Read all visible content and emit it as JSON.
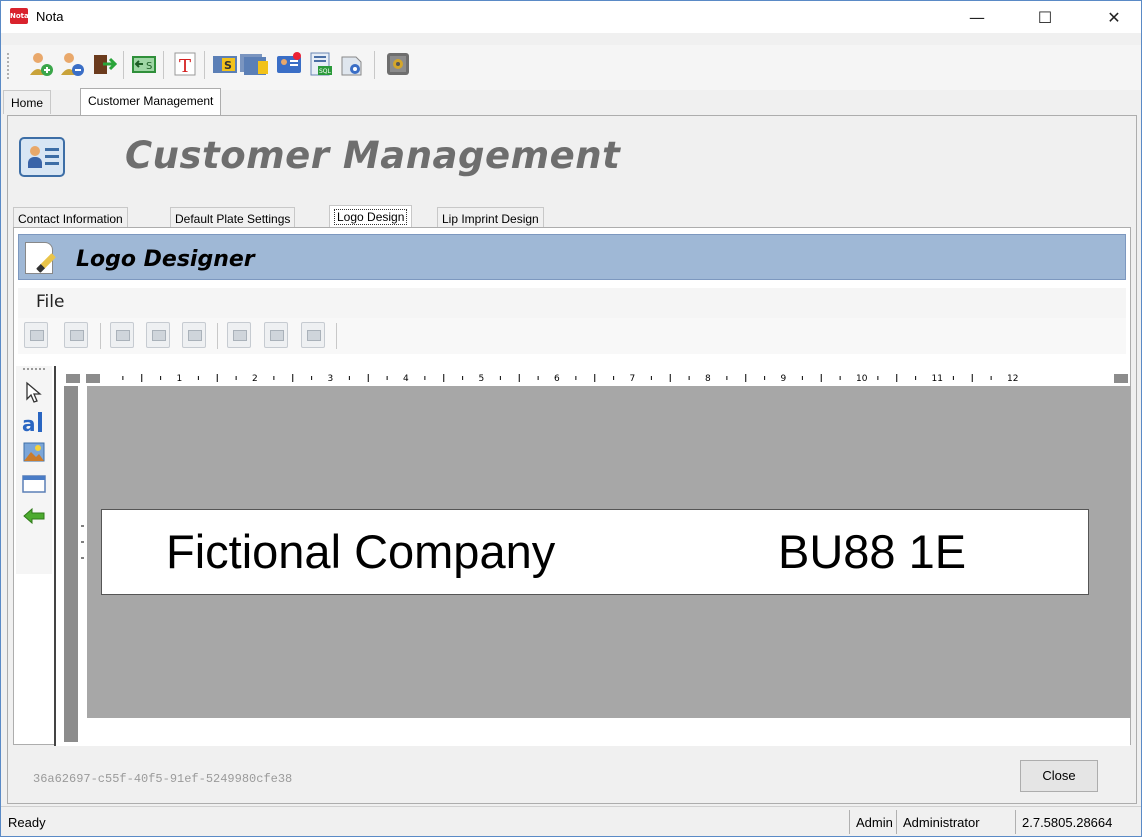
{
  "window": {
    "title": "Nota",
    "app_icon_text": "Nota",
    "controls": {
      "minimize": "—",
      "maximize": "☐",
      "close": "✕"
    }
  },
  "toolbar": {
    "buttons": [
      {
        "icon": "add-customer-icon"
      },
      {
        "icon": "edit-customer-icon"
      },
      {
        "icon": "exit-icon"
      },
      {
        "icon": "dollar-exchange-icon"
      },
      {
        "icon": "text-icon"
      },
      {
        "icon": "settings-s-icon"
      },
      {
        "icon": "multi-settings-icon"
      },
      {
        "icon": "customer-card-icon"
      },
      {
        "icon": "sql-report-icon"
      },
      {
        "icon": "print-settings-icon"
      },
      {
        "icon": "safe-icon"
      }
    ]
  },
  "main_tabs": [
    {
      "label": "Home",
      "active": false
    },
    {
      "label": "Customer Management",
      "active": true
    }
  ],
  "header": {
    "title": "Customer Management",
    "icon": "customer-list-icon"
  },
  "sub_tabs": [
    {
      "label": "Contact Information",
      "active": false
    },
    {
      "label": "Default Plate Settings",
      "active": false
    },
    {
      "label": "Logo Design",
      "active": true
    },
    {
      "label": "Lip Imprint Design",
      "active": false
    }
  ],
  "logo_designer": {
    "title": "Logo Designer",
    "menu": {
      "file": "File"
    },
    "ruler_numbers": [
      "1",
      "2",
      "3",
      "4",
      "5",
      "6",
      "7",
      "8",
      "9",
      "10",
      "11",
      "12"
    ],
    "tools": [
      {
        "icon": "pointer-icon"
      },
      {
        "icon": "text-tool-icon"
      },
      {
        "icon": "image-tool-icon"
      },
      {
        "icon": "rectangle-tool-icon"
      },
      {
        "icon": "back-arrow-icon"
      }
    ],
    "logo": {
      "company": "Fictional Company",
      "postcode": "BU88 1E"
    }
  },
  "footer": {
    "record_id": "36a62697-c55f-40f5-91ef-5249980cfe38",
    "close_label": "Close"
  },
  "status_bar": {
    "status": "Ready",
    "user": "Admin",
    "role": "Administrator",
    "version": "2.7.5805.28664"
  }
}
